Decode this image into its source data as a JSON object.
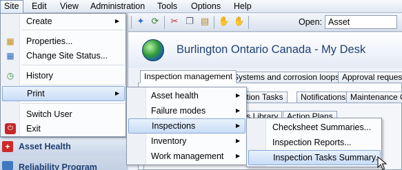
{
  "menubar": {
    "items": [
      "Site",
      "Edit",
      "View",
      "Administration",
      "Tools",
      "Options",
      "Help"
    ]
  },
  "toolbar": {
    "open_label": "Open:",
    "open_value": "Asset",
    "icons": [
      "star-icon",
      "refresh-icon",
      "cut-icon",
      "copy-icon",
      "paste-icon",
      "thumbs-up-icon",
      "thumbs-down-icon"
    ]
  },
  "desk": {
    "title": "Burlington Ontario Canada - My Desk",
    "tabs_row1": [
      "Inspection management",
      "Systems and corrosion loops",
      "Approval requests"
    ],
    "tabs_row2": [
      "Inspection Tasks",
      "Notifications",
      "Maintenance Or"
    ],
    "tabs_row3": [
      "Items Library",
      "Action Plans"
    ]
  },
  "site_menu": {
    "items": [
      {
        "label": "Create",
        "submenu": true
      },
      {
        "label": "Properties..."
      },
      {
        "label": "Change Site Status..."
      },
      {
        "label": "History"
      },
      {
        "label": "Print",
        "submenu": true
      },
      {
        "label": "Switch User"
      },
      {
        "label": "Exit"
      }
    ]
  },
  "print_menu": {
    "items": [
      {
        "label": "Asset health",
        "submenu": true
      },
      {
        "label": "Failure modes",
        "submenu": true
      },
      {
        "label": "Inspections",
        "submenu": true
      },
      {
        "label": "Inventory",
        "submenu": true
      },
      {
        "label": "Work management",
        "submenu": true
      }
    ]
  },
  "inspections_menu": {
    "items": [
      {
        "label": "Checksheet Summaries..."
      },
      {
        "label": "Inspection Reports..."
      },
      {
        "label": "Inspection Tasks Summary..."
      }
    ]
  },
  "nav": {
    "asset_health": "Asset Health",
    "reliability_program": "Reliability Program"
  },
  "colors": {
    "menu_highlight": "#c9dcf6",
    "title_blue": "#1f3f72"
  }
}
